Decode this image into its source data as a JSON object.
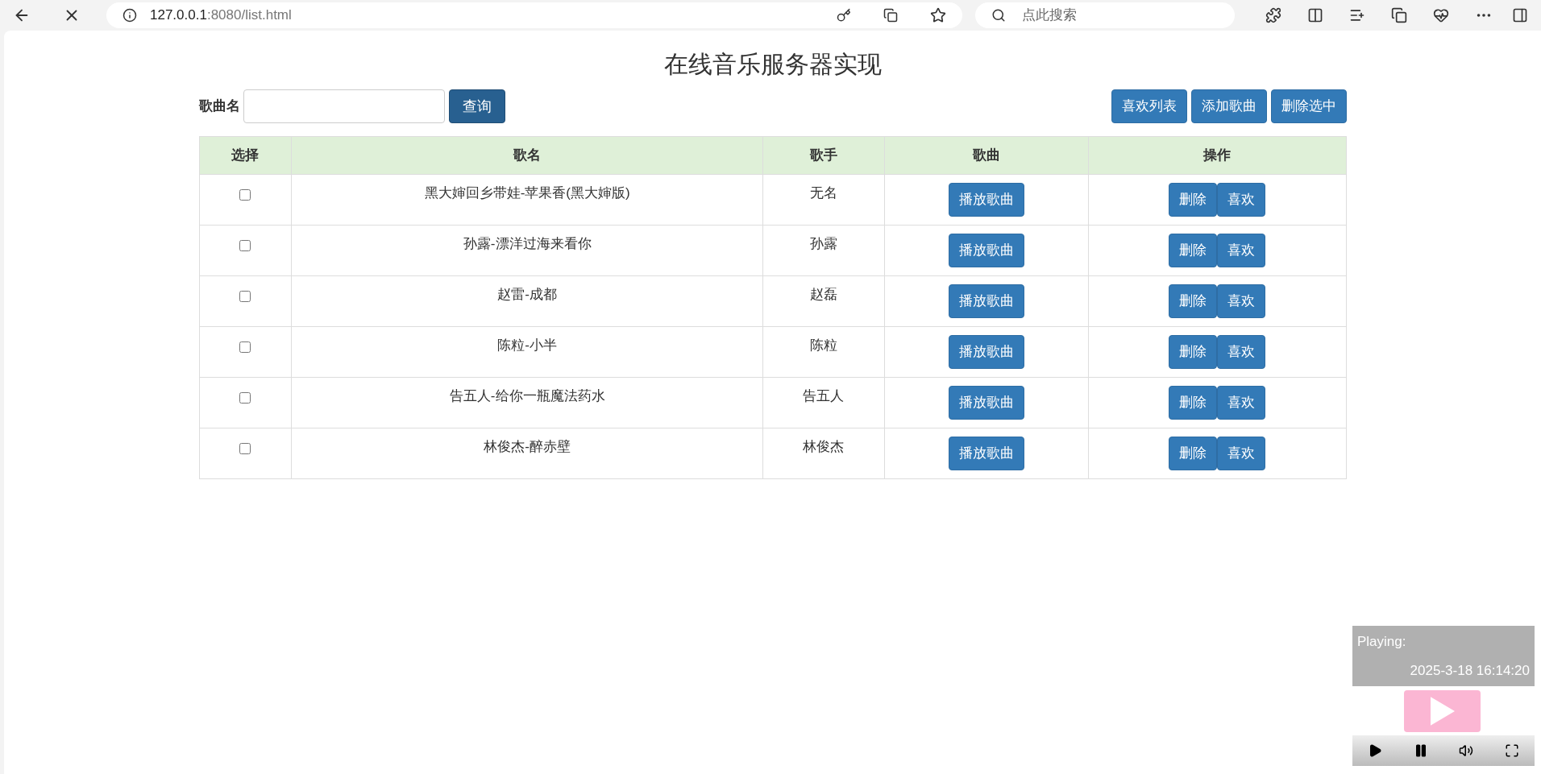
{
  "browser": {
    "url_host": "127.0.0.1",
    "url_rest": ":8080/list.html",
    "search_placeholder": "点此搜索"
  },
  "title": "在线音乐服务器实现",
  "search": {
    "label": "歌曲名",
    "button": "查询"
  },
  "actions": [
    "喜欢列表",
    "添加歌曲",
    "删除选中"
  ],
  "table": {
    "columns": [
      "选择",
      "歌名",
      "歌手",
      "歌曲",
      "操作"
    ],
    "rows": [
      {
        "checked": false,
        "title": "黑大婶回乡带娃-苹果香(黑大婶版)",
        "singer": "无名",
        "play": "播放歌曲",
        "delete": "删除",
        "like": "喜欢"
      },
      {
        "checked": false,
        "title": "孙露-漂洋过海来看你",
        "singer": "孙露",
        "play": "播放歌曲",
        "delete": "删除",
        "like": "喜欢"
      },
      {
        "checked": false,
        "title": "赵雷-成都",
        "singer": "赵磊",
        "play": "播放歌曲",
        "delete": "删除",
        "like": "喜欢"
      },
      {
        "checked": false,
        "title": "陈粒-小半",
        "singer": "陈粒",
        "play": "播放歌曲",
        "delete": "删除",
        "like": "喜欢"
      },
      {
        "checked": false,
        "title": "告五人-给你一瓶魔法药水",
        "singer": "告五人",
        "play": "播放歌曲",
        "delete": "删除",
        "like": "喜欢"
      },
      {
        "checked": false,
        "title": "林俊杰-醉赤壁",
        "singer": "林俊杰",
        "play": "播放歌曲",
        "delete": "删除",
        "like": "喜欢"
      }
    ]
  },
  "player": {
    "status": "Playing:",
    "time": "2025-3-18 16:14:20"
  }
}
